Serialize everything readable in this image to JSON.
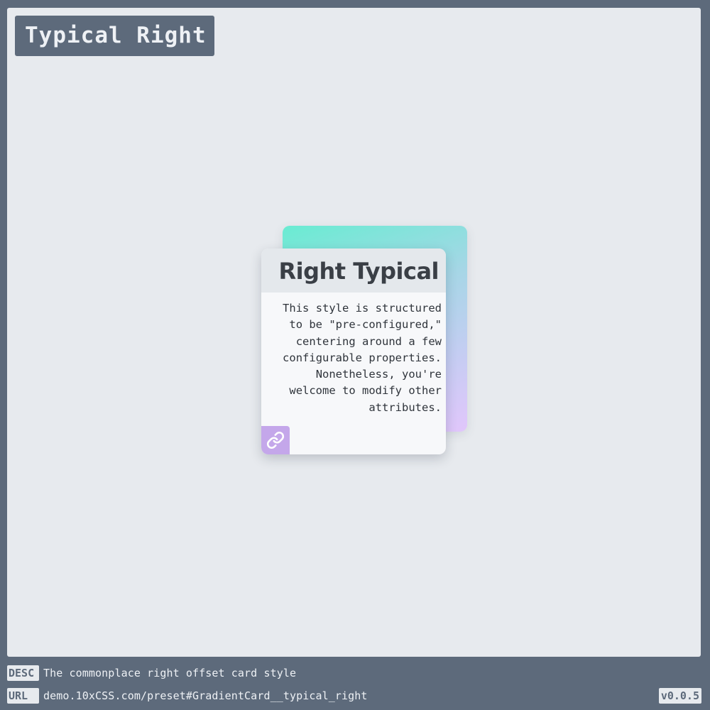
{
  "page": {
    "title": "Typical Right"
  },
  "card": {
    "title": "Right Typical",
    "body": "This style is structured to be \"pre-configured,\" centering around a few configurable properties. Nonetheless, you're welcome to modify other attributes.",
    "link_icon": "link-icon",
    "colors": {
      "gradient_start": "#69ecd2",
      "gradient_mid": "#a6d6e6",
      "gradient_end": "#e1c6fb",
      "link_button": "#c4a7ea"
    }
  },
  "footer": {
    "desc_tag": "DESC",
    "desc_text": "The commonplace right offset card style",
    "url_tag": "URL",
    "url_text": "demo.10xCSS.com/preset#GradientCard__typical_right",
    "version": "v0.0.5"
  },
  "colors": {
    "background": "#5d6a7b",
    "stage": "#e7eaee"
  }
}
